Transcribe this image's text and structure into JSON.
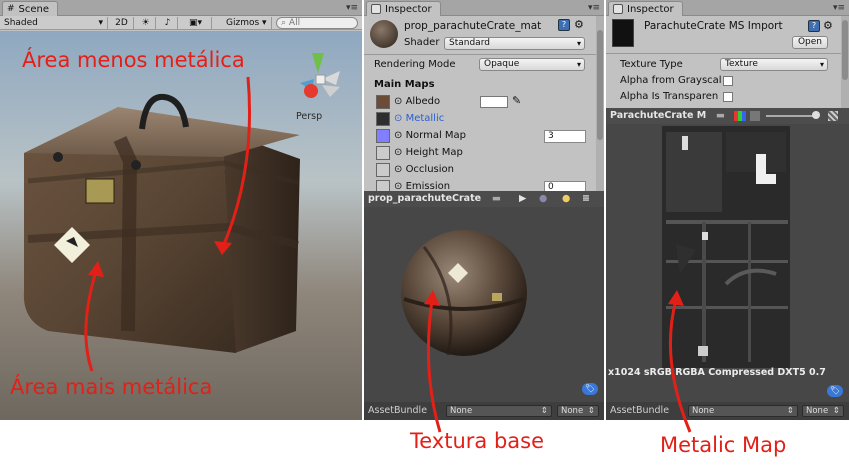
{
  "scene": {
    "tab_label": "Scene",
    "shading": "Shaded",
    "btn_2d": "2D",
    "gizmos": "Gizmos",
    "search_placeholder": "All",
    "persp": "Persp",
    "annotation_top": "Área menos metálica",
    "annotation_bottom": "Área mais metálica"
  },
  "inspector_material": {
    "tab_label": "Inspector",
    "material_name": "prop_parachuteCrate_mat",
    "shader_label": "Shader",
    "shader_value": "Standard",
    "rendering_mode_label": "Rendering Mode",
    "rendering_mode_value": "Opaque",
    "main_maps": "Main Maps",
    "props": [
      {
        "label": "Albedo",
        "value": ""
      },
      {
        "label": "Metallic",
        "value": ""
      },
      {
        "label": "Normal Map",
        "value": "3"
      },
      {
        "label": "Height Map",
        "value": ""
      },
      {
        "label": "Occlusion",
        "value": ""
      },
      {
        "label": "Emission",
        "value": "0"
      }
    ],
    "preview_title": "prop_parachuteCrate",
    "assetbundle_label": "AssetBundle",
    "assetbundle_value": "None",
    "assetbundle_variant": "None",
    "caption": "Textura base"
  },
  "inspector_texture": {
    "tab_label": "Inspector",
    "title": "ParachuteCrate MS Import",
    "open_button": "Open",
    "texture_type_label": "Texture Type",
    "texture_type_value": "Texture",
    "alpha_grayscale": "Alpha from Grayscal",
    "alpha_transparent": "Alpha Is Transparen",
    "preview_title": "ParachuteCrate M",
    "info_text": "x1024 sRGB  RGBA Compressed DXT5  0.7",
    "assetbundle_label": "AssetBundle",
    "assetbundle_value": "None",
    "assetbundle_variant": "None",
    "caption": "Metalic Map"
  },
  "colors": {
    "annotation": "#e32018",
    "panel": "#c2c2c2",
    "dark_preview": "#474747",
    "link_blue": "#2a5fd0"
  }
}
